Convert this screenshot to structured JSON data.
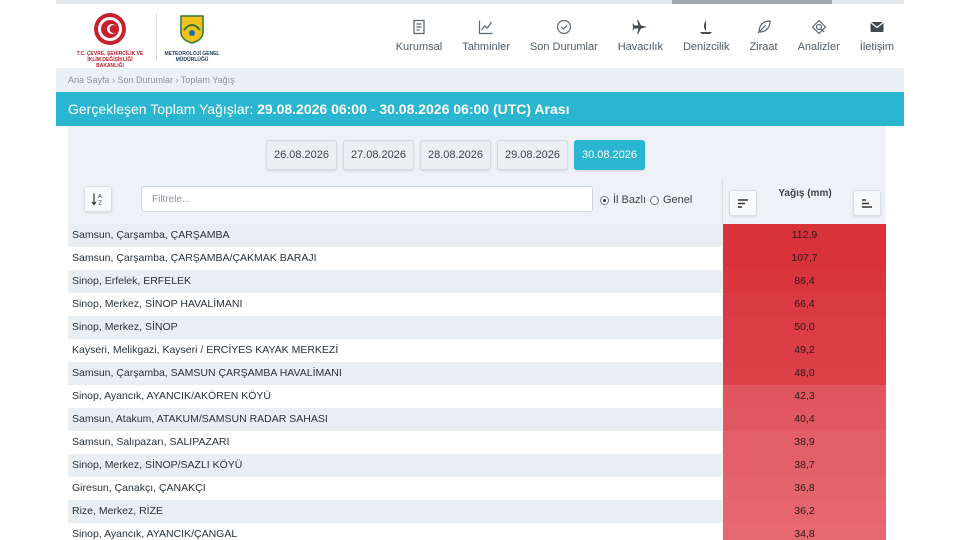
{
  "header": {
    "ministry_caption": "T.C. ÇEVRE, ŞEHİRCİLİK VE İKLİM DEĞİŞİKLİĞİ BAKANLIĞI",
    "mgm_caption": "METEOROLOJİ GENEL MÜDÜRLÜĞÜ",
    "menu": [
      {
        "label": "Kurumsal",
        "icon": "document-icon"
      },
      {
        "label": "Tahminler",
        "icon": "chart-icon"
      },
      {
        "label": "Son Durumlar",
        "icon": "clock-icon"
      },
      {
        "label": "Havacılık",
        "icon": "plane-icon"
      },
      {
        "label": "Denizcilik",
        "icon": "sail-icon"
      },
      {
        "label": "Ziraat",
        "icon": "leaf-icon"
      },
      {
        "label": "Analizler",
        "icon": "analysis-icon"
      },
      {
        "label": "İletişim",
        "icon": "mail-icon"
      }
    ]
  },
  "breadcrumb": {
    "item1": "Ana Sayfa",
    "item2": "Son Durumlar",
    "item3": "Toplam Yağış",
    "sep": " › "
  },
  "title": {
    "prefix": "Gerçekleşen Toplam Yağışlar: ",
    "range": "29.08.2026 06:00 - 30.08.2026 06:00 (UTC) Arası"
  },
  "dates": [
    "26.08.2026",
    "27.08.2026",
    "28.08.2026",
    "29.08.2026",
    "30.08.2026"
  ],
  "active_date": "30.08.2026",
  "filter": {
    "placeholder": "Filtrele...",
    "radio_city": "İl Bazlı",
    "radio_general": "Genel",
    "selected": "İl Bazlı"
  },
  "column_header": "Yağış (mm)",
  "rows": [
    {
      "name": "Samsun, Çarşamba, ÇARŞAMBA",
      "value": "112,9",
      "color": "#d8323c"
    },
    {
      "name": "Samsun, Çarşamba, ÇARŞAMBA/ÇAKMAK BARAJI",
      "value": "107,7",
      "color": "#d8323c"
    },
    {
      "name": "Sinop, Erfelek, ERFELEK",
      "value": "86,4",
      "color": "#d8353f"
    },
    {
      "name": "Sinop, Merkez, SİNOP HAVALİMANI",
      "value": "66,4",
      "color": "#da3a43"
    },
    {
      "name": "Sinop, Merkez, SİNOP",
      "value": "50,0",
      "color": "#db3c45"
    },
    {
      "name": "Kayseri, Melikgazi, Kayseri / ERCİYES KAYAK MERKEZİ",
      "value": "49,2",
      "color": "#dc3e47"
    },
    {
      "name": "Samsun, Çarşamba, SAMSUN ÇARŞAMBA HAVALİMANI",
      "value": "48,0",
      "color": "#dc3f48"
    },
    {
      "name": "Sinop, Ayancık, AYANCIK/AKÖREN KÖYÜ",
      "value": "42,3",
      "color": "#e05560"
    },
    {
      "name": "Samsun, Atakum, ATAKUM/SAMSUN RADAR SAHASI",
      "value": "40,4",
      "color": "#e15862"
    },
    {
      "name": "Samsun, Salıpazarı, SALIPAZARI",
      "value": "38,9",
      "color": "#e35f69"
    },
    {
      "name": "Sinop, Merkez, SİNOP/SAZLI KÖYÜ",
      "value": "38,7",
      "color": "#e3606a"
    },
    {
      "name": "Giresun, Çanakçı, ÇANAKÇI",
      "value": "36,8",
      "color": "#e4646d"
    },
    {
      "name": "Rize, Merkez, RİZE",
      "value": "36,2",
      "color": "#e56670"
    },
    {
      "name": "Sinop, Ayancık, AYANCIK/ÇANGAL",
      "value": "34,8",
      "color": "#e56872"
    }
  ]
}
